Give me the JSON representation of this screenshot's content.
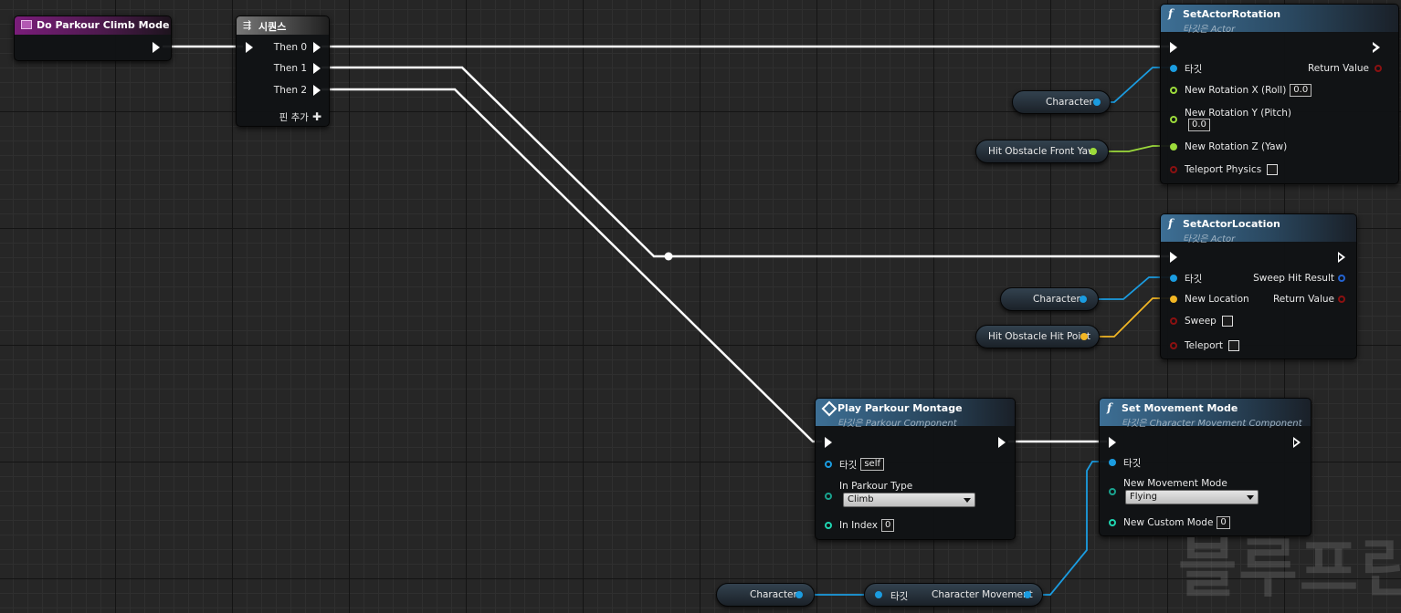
{
  "colors": {
    "exec": "#ffffff",
    "object_pin": "#1b9ce0",
    "rotator_pin": "#9cdb3b",
    "vector_pin": "#f2b624",
    "bool_pin": "#8b1111",
    "enum_pin": "#1aa38f",
    "int_pin": "#1fd4b0",
    "hitresult_pin": "#2463d0"
  },
  "event_node": {
    "title": "Do Parkour Climb Mode",
    "icon": "event-icon"
  },
  "sequence_node": {
    "title": "시퀀스",
    "icon": "sequence-icon",
    "outputs": [
      "Then 0",
      "Then 1",
      "Then 2"
    ],
    "add_pin": "핀 추가"
  },
  "set_rotation": {
    "title": "SetActorRotation",
    "subtitle": "타깃은 Actor",
    "target_label": "타깃",
    "return_label": "Return Value",
    "roll_label": "New Rotation X (Roll)",
    "roll_value": "0.0",
    "pitch_label": "New Rotation Y (Pitch)",
    "pitch_value": "0.0",
    "yaw_label": "New Rotation Z (Yaw)",
    "teleport_label": "Teleport Physics"
  },
  "set_location": {
    "title": "SetActorLocation",
    "subtitle": "타깃은 Actor",
    "target_label": "타깃",
    "sweep_result_label": "Sweep Hit Result",
    "new_location_label": "New Location",
    "return_label": "Return Value",
    "sweep_label": "Sweep",
    "teleport_label": "Teleport"
  },
  "play_montage": {
    "title": "Play Parkour Montage",
    "subtitle": "타깃은 Parkour Component",
    "target_label": "타깃",
    "target_value": "self",
    "type_label": "In Parkour Type",
    "type_value": "Climb",
    "index_label": "In Index",
    "index_value": "0"
  },
  "set_movement": {
    "title": "Set Movement Mode",
    "subtitle": "타깃은 Character Movement Component",
    "target_label": "타깃",
    "mode_label": "New Movement Mode",
    "mode_value": "Flying",
    "custom_label": "New Custom Mode",
    "custom_value": "0"
  },
  "getters": {
    "character_1": "Character",
    "front_yaw": "Hit Obstacle Front Yaw",
    "character_2": "Character",
    "hit_point": "Hit Obstacle Hit Point",
    "character_3": "Character",
    "char_movement_target": "타깃",
    "char_movement": "Character Movement"
  },
  "watermark": "블루프린"
}
